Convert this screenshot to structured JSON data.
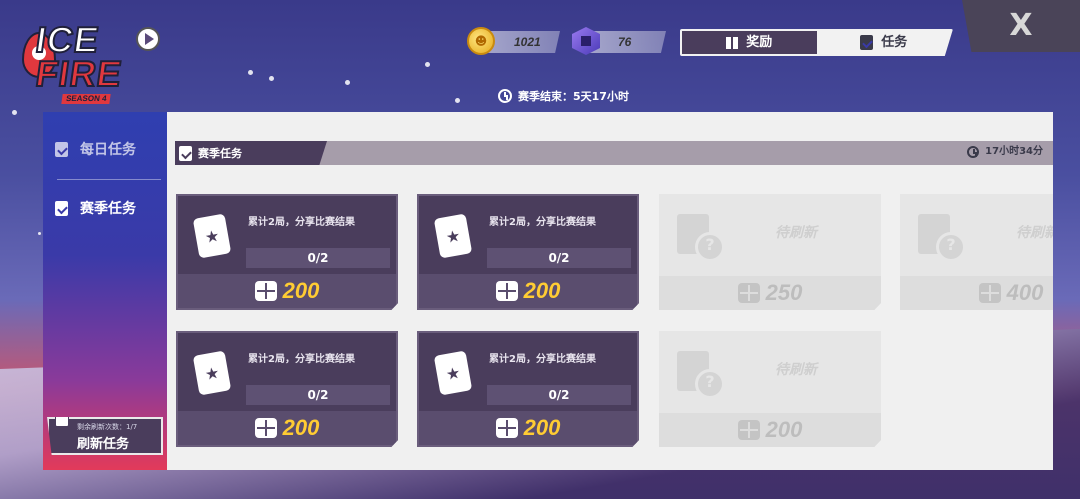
{
  "logo": {
    "line1": "ICE",
    "line2": "FIRE",
    "season": "SEASON 4"
  },
  "currency": {
    "coins": {
      "icon": "coin-icon",
      "value": "1021"
    },
    "gems": {
      "icon": "gem-icon",
      "value": "76"
    }
  },
  "top_tabs": [
    {
      "label": "奖励",
      "icon": "gift-icon",
      "active": true
    },
    {
      "label": "任务",
      "icon": "clipboard-icon",
      "active": false
    }
  ],
  "close": {
    "label": "X"
  },
  "season_end": {
    "label": "赛季结束：5天17小时"
  },
  "sidebar": {
    "items": [
      {
        "label": "每日任务",
        "active": false
      },
      {
        "label": "赛季任务",
        "active": true
      }
    ],
    "refresh": {
      "count_text": "剩余刷新次数：1/7",
      "label": "刷新任务"
    }
  },
  "section": {
    "title": "赛季任务",
    "timer": "17小时34分"
  },
  "tasks": [
    {
      "state": "active",
      "desc": "累计2局，分享比赛结果",
      "progress": "0/2",
      "reward": "200"
    },
    {
      "state": "active",
      "desc": "累计2局，分享比赛结果",
      "progress": "0/2",
      "reward": "200"
    },
    {
      "state": "pending",
      "label": "待刷新",
      "reward": "250"
    },
    {
      "state": "pending",
      "label": "待刷新",
      "reward": "400"
    },
    {
      "state": "active",
      "desc": "累计2局，分享比赛结果",
      "progress": "0/2",
      "reward": "200"
    },
    {
      "state": "active",
      "desc": "累计2局，分享比赛结果",
      "progress": "0/2",
      "reward": "200"
    },
    {
      "state": "pending",
      "label": "待刷新",
      "reward": "200"
    }
  ],
  "colors": {
    "accent": "#4a3d5c",
    "reward": "#ffcc33",
    "panel": "#f0f0f0"
  }
}
